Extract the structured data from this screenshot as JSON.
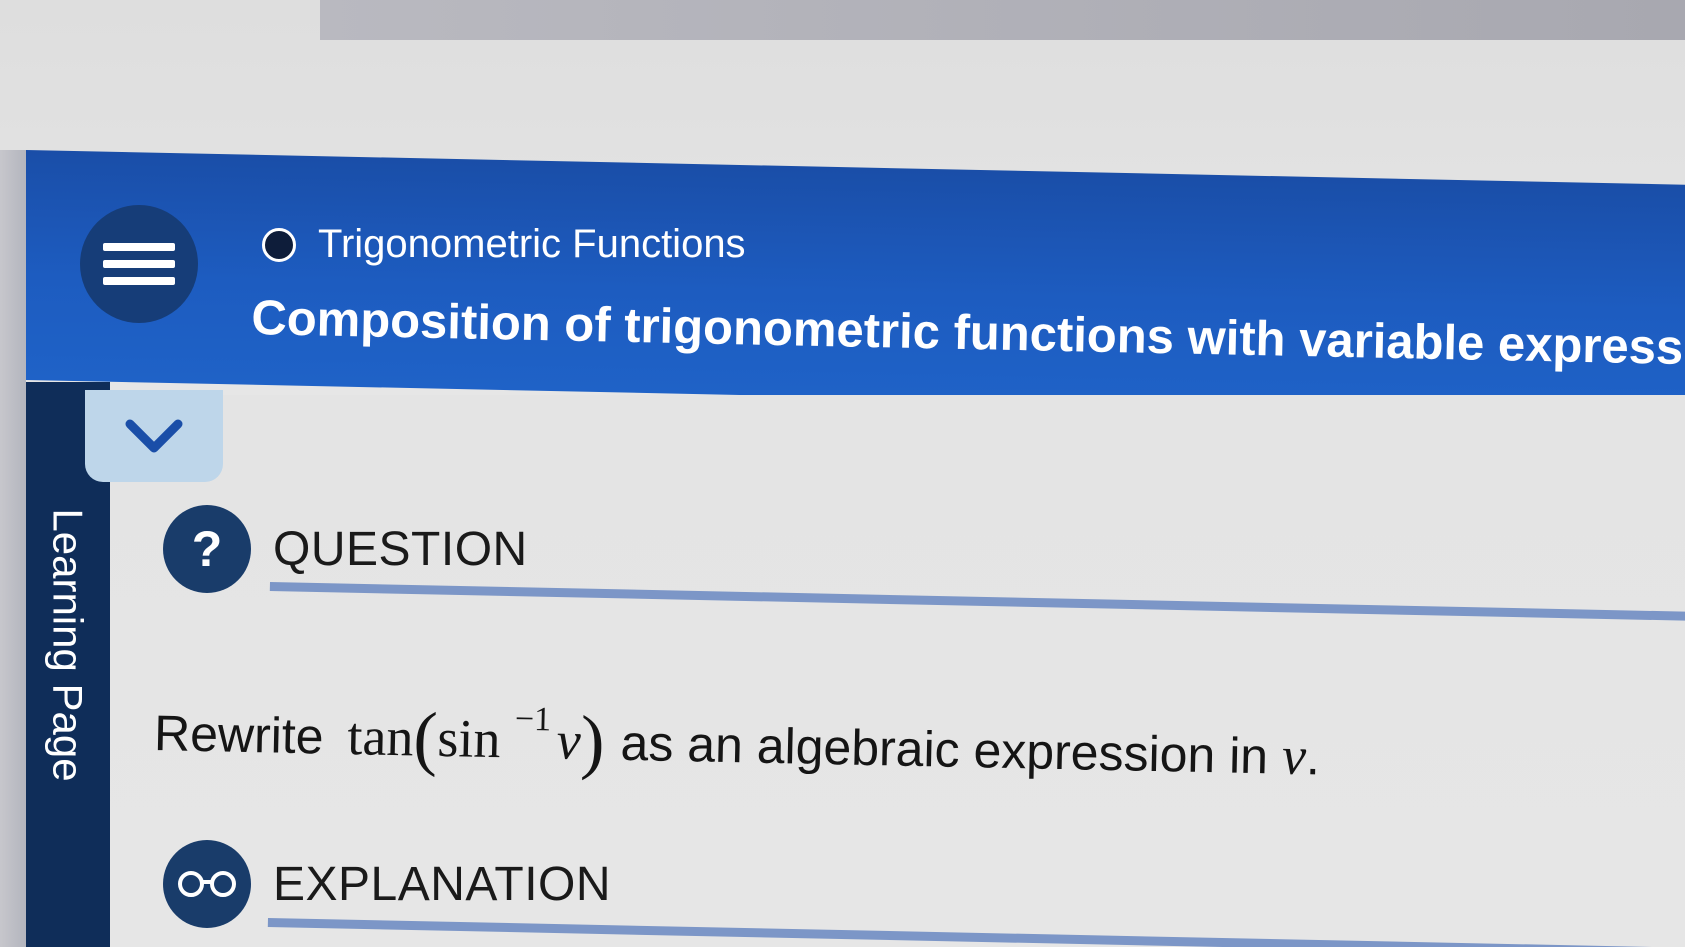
{
  "header": {
    "menu_icon": "hamburger-menu-icon",
    "breadcrumb": "Trigonometric Functions",
    "title": "Composition of trigonometric functions with variable expressions a"
  },
  "sidebar": {
    "tab_label": "Learning Page"
  },
  "collapse_icon": "chevron-down-icon",
  "question": {
    "icon_glyph": "?",
    "label": "QUESTION",
    "prompt_prefix": "Rewrite",
    "math_fn": "tan",
    "math_open": "(",
    "math_inner": "sin",
    "math_exp": "−1",
    "math_var": "v",
    "math_close": ")",
    "prompt_suffix": "as an algebraic expression in",
    "prompt_var": "v",
    "prompt_end": "."
  },
  "explanation": {
    "icon": "glasses-icon",
    "label": "EXPLANATION"
  },
  "colors": {
    "header_blue": "#1d5cc0",
    "dark_navy": "#163d78",
    "side_tab": "#0f2d59",
    "collapse_tab": "#bed6ea",
    "rule": "#7c96c7"
  }
}
